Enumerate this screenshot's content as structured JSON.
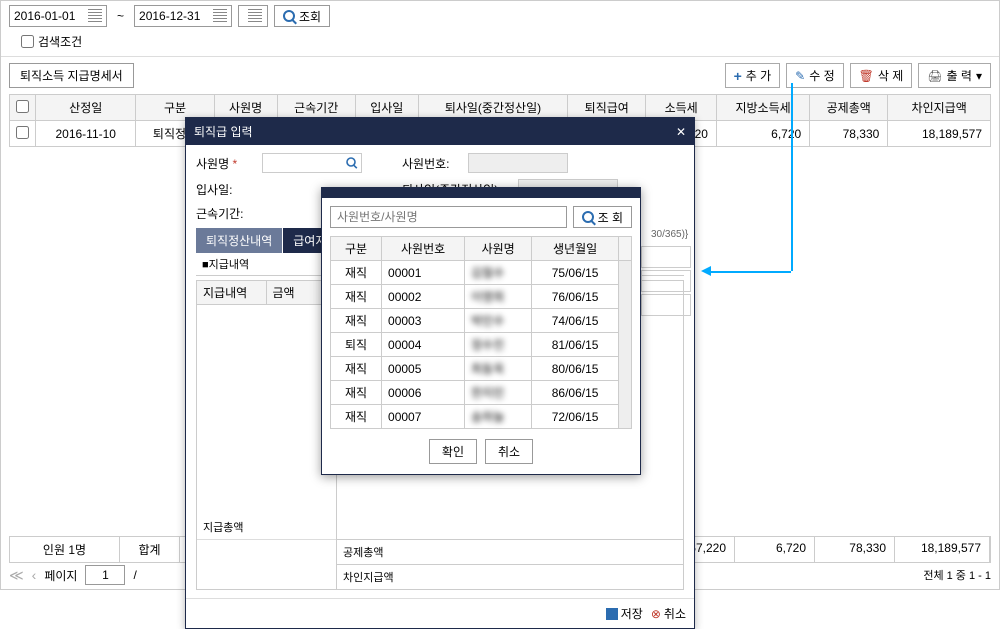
{
  "date_from": "2016-01-01",
  "date_to": "2016-12-31",
  "query_label": "조회",
  "search_cond": "검색조건",
  "tab_label": "퇴직소득 지급명세서",
  "actions": {
    "add": "추 가",
    "edit": "수 정",
    "del": "삭 제",
    "print": "출 력"
  },
  "cols": [
    "산정일",
    "구분",
    "사원명",
    "근속기간",
    "입사일",
    "퇴사일(중간정산일)",
    "퇴직급여",
    "소득세",
    "지방소득세",
    "공제총액",
    "차인지급액"
  ],
  "rows": [
    {
      "date": "2016-11-10",
      "type": "퇴직정산",
      "tax": "67,220",
      "ltax": "6,720",
      "deduct": "78,330",
      "net": "18,189,577"
    }
  ],
  "dialog1": {
    "title": "퇴직급 입력",
    "labels": {
      "name": "사원명",
      "empno": "사원번호:",
      "hire": "입사일:",
      "retire": "퇴사일(중간정산일):",
      "tenure": "근속기간:"
    },
    "subtabs": [
      "퇴직정산내역",
      "급여지급내역"
    ],
    "pay_label": "■지급내역",
    "pay_headers": [
      "지급내역",
      "금액"
    ],
    "totals": {
      "pay": "지급총액",
      "deduct": "공제총액",
      "net": "차인지급액"
    },
    "save": "저장",
    "cancel": "취소"
  },
  "dialog2": {
    "placeholder": "사원번호/사원명",
    "query": "조 회",
    "cols": [
      "구분",
      "사원번호",
      "사원명",
      "생년월일"
    ],
    "rows": [
      {
        "s": "재직",
        "no": "00001",
        "nm": "김철수",
        "b": "75/06/15"
      },
      {
        "s": "재직",
        "no": "00002",
        "nm": "이영희",
        "b": "76/06/15"
      },
      {
        "s": "재직",
        "no": "00003",
        "nm": "박민수",
        "b": "74/06/15"
      },
      {
        "s": "퇴직",
        "no": "00004",
        "nm": "정수진",
        "b": "81/06/15"
      },
      {
        "s": "재직",
        "no": "00005",
        "nm": "최동욱",
        "b": "80/06/15"
      },
      {
        "s": "재직",
        "no": "00006",
        "nm": "한지민",
        "b": "86/06/15"
      },
      {
        "s": "재직",
        "no": "00007",
        "nm": "송하늘",
        "b": "72/06/15"
      }
    ],
    "ok": "확인",
    "cancel": "취소"
  },
  "right_note": "30/365)}",
  "summary": {
    "count_label": "인원 1명",
    "sum_label": "합계",
    "tax": "67,220",
    "ltax": "6,720",
    "deduct": "78,330",
    "net": "18,189,577"
  },
  "paging": {
    "label": "페이지",
    "page": "1",
    "slash": "/",
    "total": "전체 1 중 1 - 1"
  }
}
